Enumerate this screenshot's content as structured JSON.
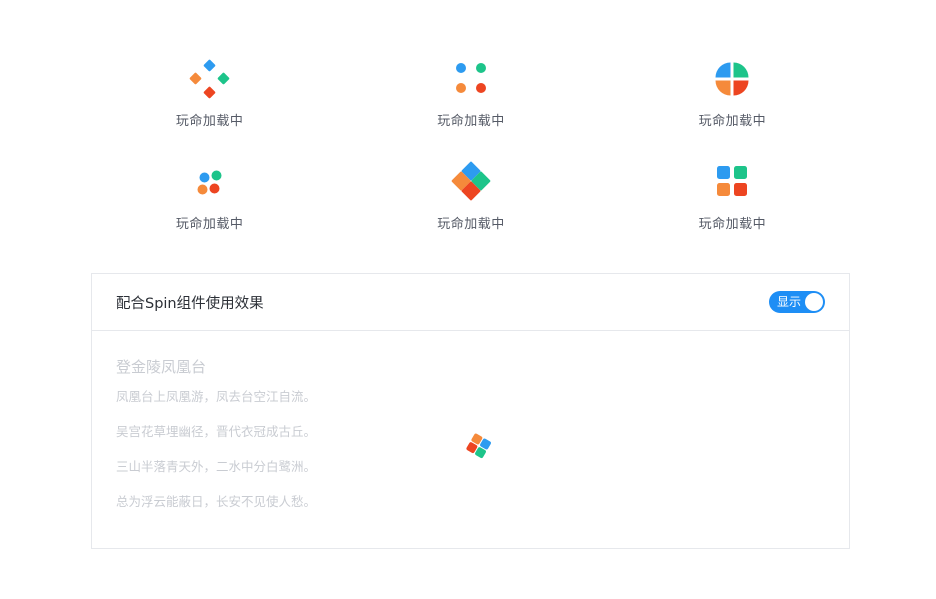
{
  "colors": {
    "blue": "#2d9bf0",
    "green": "#1dc48a",
    "orange": "#f58a3b",
    "red": "#ed4521",
    "accent": "#1e8ef5"
  },
  "loaders": [
    {
      "variant": "diamond-dots",
      "icon": "diamond-dots-loader-icon",
      "label": "玩命加载中"
    },
    {
      "variant": "four-dots",
      "icon": "four-dots-loader-icon",
      "label": "玩命加载中"
    },
    {
      "variant": "quarter-circle",
      "icon": "quarter-circle-loader-icon",
      "label": "玩命加载中"
    },
    {
      "variant": "cluster-dots",
      "icon": "cluster-dots-loader-icon",
      "label": "玩命加载中"
    },
    {
      "variant": "big-diamond",
      "icon": "big-diamond-loader-icon",
      "label": "玩命加载中"
    },
    {
      "variant": "four-squares",
      "icon": "four-squares-loader-icon",
      "label": "玩命加载中"
    }
  ],
  "card": {
    "title": "配合Spin组件使用效果",
    "switch": {
      "label": "显示",
      "checked": true
    },
    "poem": {
      "title": "登金陵凤凰台",
      "lines": [
        "凤凰台上凤凰游，凤去台空江自流。",
        "吴宫花草埋幽径，晋代衣冠成古丘。",
        "三山半落青天外，二水中分白鹭洲。",
        "总为浮云能蔽日，长安不见使人愁。"
      ]
    },
    "spinner_icon": "spinning-squares-icon"
  }
}
